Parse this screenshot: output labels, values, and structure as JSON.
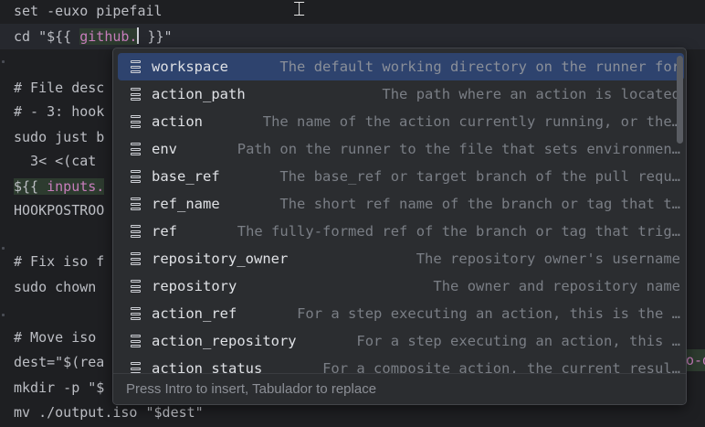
{
  "editor": {
    "lines": [
      {
        "text": "set -euxo pipefail"
      },
      {
        "prefix": "cd \"${{ ",
        "expr": "github.",
        "suffix": " }}\""
      },
      {
        "text": "# File desc"
      },
      {
        "text": "# - 3: hook"
      },
      {
        "text": "sudo just b"
      },
      {
        "text": "  3< <(cat "
      },
      {
        "prefix": "${{ ",
        "expr": "inputs.",
        "suffix": ""
      },
      {
        "text": "HOOKPOSTROO"
      },
      {
        "text": "# Fix iso f"
      },
      {
        "text": "sudo chown "
      },
      {
        "text": "# Move iso "
      },
      {
        "text": "dest=\"$(rea"
      },
      {
        "text": "mkdir -p \"$"
      },
      {
        "text": "mv ./output.iso \"$dest\""
      }
    ],
    "right_fragment": "o-d"
  },
  "completion": {
    "items": [
      {
        "name": "workspace",
        "desc": "The default working directory on the runner for",
        "selected": true
      },
      {
        "name": "action_path",
        "desc": "The path where an action is located"
      },
      {
        "name": "action",
        "desc": "The name of the action currently running, or the…"
      },
      {
        "name": "env",
        "desc": "Path on the runner to the file that sets environmen…"
      },
      {
        "name": "base_ref",
        "desc": "The base_ref or target branch of the pull requ…"
      },
      {
        "name": "ref_name",
        "desc": "The short ref name of the branch or tag that t…"
      },
      {
        "name": "ref",
        "desc": "The fully-formed ref of the branch or tag that trig…"
      },
      {
        "name": "repository_owner",
        "desc": "The repository owner's username"
      },
      {
        "name": "repository",
        "desc": "The owner and repository name"
      },
      {
        "name": "action_ref",
        "desc": "For a step executing an action, this is the …"
      },
      {
        "name": "action_repository",
        "desc": "For a step executing an action, this …"
      },
      {
        "name": "action_status",
        "desc": "For a composite action, the current resul…"
      }
    ],
    "icon": "field-icon",
    "footer": "Press Intro to insert, Tabulador to replace"
  }
}
